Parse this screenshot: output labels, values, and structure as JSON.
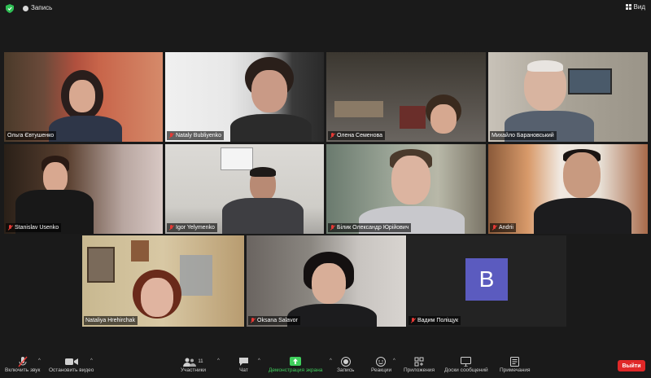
{
  "topbar": {
    "record_label": "Запись",
    "view_label": "Вид"
  },
  "participants": [
    {
      "name": "Ольга Євтушенко",
      "muted": false
    },
    {
      "name": "Nataly Bubliyenko",
      "muted": true
    },
    {
      "name": "Олена Семенова",
      "muted": true
    },
    {
      "name": "Михайло Барановський",
      "muted": false
    },
    {
      "name": "Stanislav Usenko",
      "muted": true
    },
    {
      "name": "Igor Yelymenko",
      "muted": true
    },
    {
      "name": "Білик Олександр Юрійович",
      "muted": true
    },
    {
      "name": "Andrii",
      "muted": true
    },
    {
      "name": "Nataliya Hrehirchak",
      "muted": false
    },
    {
      "name": "Oksana Salavor",
      "muted": true
    },
    {
      "name": "Вадим Поліщук",
      "muted": true,
      "avatar_letter": "B"
    }
  ],
  "toolbar": {
    "mute_label": "Включить звук",
    "video_label": "Остановить видео",
    "participants_label": "Участники",
    "participants_count": "11",
    "chat_label": "Чат",
    "share_label": "Демонстрация экрана",
    "record_label": "Запись",
    "reactions_label": "Реакции",
    "apps_label": "Приложения",
    "whiteboards_label": "Доски сообщений",
    "notes_label": "Примечания",
    "leave_label": "Выйти"
  },
  "colors": {
    "background": "#1a1a1a",
    "active_speaker": "#c6e83a",
    "leave": "#e02828",
    "share": "#3fcf5c",
    "avatar": "#5b5bbf"
  }
}
